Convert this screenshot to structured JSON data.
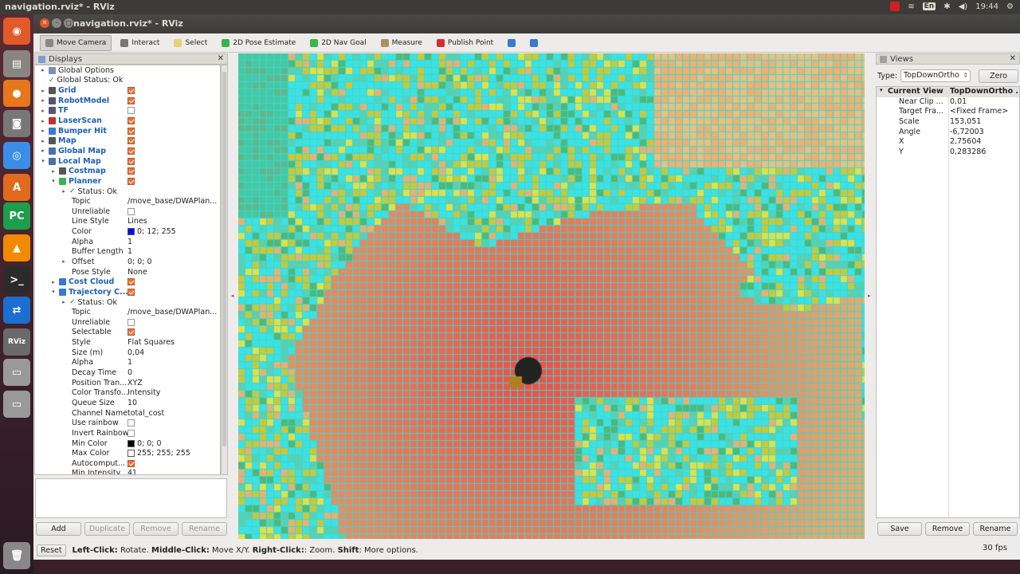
{
  "top_panel": {
    "window_title": "navigation.rviz* - RViz",
    "clock": "19:44",
    "lang": "En"
  },
  "window": {
    "title": "navigation.rviz* - RViz"
  },
  "toolbar": [
    {
      "label": "Move Camera",
      "icon": "move-camera-icon",
      "active": true
    },
    {
      "label": "Interact",
      "icon": "interact-icon",
      "active": false
    },
    {
      "label": "Select",
      "icon": "select-icon",
      "active": false
    },
    {
      "label": "2D Pose Estimate",
      "icon": "pose-estimate-icon",
      "active": false
    },
    {
      "label": "2D Nav Goal",
      "icon": "nav-goal-icon",
      "active": false
    },
    {
      "label": "Measure",
      "icon": "measure-icon",
      "active": false
    },
    {
      "label": "Publish Point",
      "icon": "publish-point-icon",
      "active": false
    },
    {
      "label": "",
      "icon": "plus-icon",
      "active": false
    },
    {
      "label": "",
      "icon": "minus-icon",
      "active": false
    }
  ],
  "displays_panel": {
    "title": "Displays",
    "rows": [
      {
        "indent": 0,
        "arrow": "▸",
        "icon": "gear",
        "name": "Global Options",
        "value": "",
        "blue": false
      },
      {
        "indent": 0,
        "arrow": "",
        "icon": "check",
        "name": "Global Status: Ok",
        "value": "",
        "blue": false
      },
      {
        "indent": 0,
        "arrow": "▸",
        "icon": "grid",
        "name": "Grid",
        "check": true,
        "blue": true
      },
      {
        "indent": 0,
        "arrow": "▸",
        "icon": "robot",
        "name": "RobotModel",
        "check": true,
        "blue": true
      },
      {
        "indent": 0,
        "arrow": "▸",
        "icon": "tf",
        "name": "TF",
        "check": false,
        "blue": true
      },
      {
        "indent": 0,
        "arrow": "▸",
        "icon": "laser",
        "name": "LaserScan",
        "check": true,
        "blue": true
      },
      {
        "indent": 0,
        "arrow": "▸",
        "icon": "bumper",
        "name": "Bumper Hit",
        "check": true,
        "blue": true
      },
      {
        "indent": 0,
        "arrow": "▸",
        "icon": "map",
        "name": "Map",
        "check": true,
        "blue": true
      },
      {
        "indent": 0,
        "arrow": "▸",
        "icon": "folder",
        "name": "Global Map",
        "check": true,
        "blue": true
      },
      {
        "indent": 0,
        "arrow": "▾",
        "icon": "folder",
        "name": "Local Map",
        "check": true,
        "blue": true
      },
      {
        "indent": 1,
        "arrow": "▸",
        "icon": "map",
        "name": "Costmap",
        "check": true,
        "blue": true
      },
      {
        "indent": 1,
        "arrow": "▾",
        "icon": "path",
        "name": "Planner",
        "check": true,
        "blue": true
      },
      {
        "indent": 2,
        "arrow": "▸",
        "icon": "check",
        "name": "Status: Ok",
        "value": "",
        "blue": false
      },
      {
        "indent": 2,
        "arrow": "",
        "icon": "",
        "name": "Topic",
        "value": "/move_base/DWAPlan...",
        "blue": false
      },
      {
        "indent": 2,
        "arrow": "",
        "icon": "",
        "name": "Unreliable",
        "check": false,
        "blue": false
      },
      {
        "indent": 2,
        "arrow": "",
        "icon": "",
        "name": "Line Style",
        "value": "Lines",
        "blue": false
      },
      {
        "indent": 2,
        "arrow": "",
        "icon": "",
        "name": "Color",
        "value": "0; 12; 255",
        "swatch": "#000cff",
        "blue": false
      },
      {
        "indent": 2,
        "arrow": "",
        "icon": "",
        "name": "Alpha",
        "value": "1",
        "blue": false
      },
      {
        "indent": 2,
        "arrow": "",
        "icon": "",
        "name": "Buffer Length",
        "value": "1",
        "blue": false
      },
      {
        "indent": 2,
        "arrow": "▸",
        "icon": "",
        "name": "Offset",
        "value": "0; 0; 0",
        "blue": false
      },
      {
        "indent": 2,
        "arrow": "",
        "icon": "",
        "name": "Pose Style",
        "value": "None",
        "blue": false
      },
      {
        "indent": 1,
        "arrow": "▸",
        "icon": "cloud",
        "name": "Cost Cloud",
        "check": true,
        "blue": true
      },
      {
        "indent": 1,
        "arrow": "▾",
        "icon": "cloud",
        "name": "Trajectory C...",
        "check": true,
        "blue": true
      },
      {
        "indent": 2,
        "arrow": "▸",
        "icon": "check",
        "name": "Status: Ok",
        "value": "",
        "blue": false
      },
      {
        "indent": 2,
        "arrow": "",
        "icon": "",
        "name": "Topic",
        "value": "/move_base/DWAPlan...",
        "blue": false
      },
      {
        "indent": 2,
        "arrow": "",
        "icon": "",
        "name": "Unreliable",
        "check": false,
        "blue": false
      },
      {
        "indent": 2,
        "arrow": "",
        "icon": "",
        "name": "Selectable",
        "check": true,
        "blue": false
      },
      {
        "indent": 2,
        "arrow": "",
        "icon": "",
        "name": "Style",
        "value": "Flat Squares",
        "blue": false
      },
      {
        "indent": 2,
        "arrow": "",
        "icon": "",
        "name": "Size (m)",
        "value": "0,04",
        "blue": false
      },
      {
        "indent": 2,
        "arrow": "",
        "icon": "",
        "name": "Alpha",
        "value": "1",
        "blue": false
      },
      {
        "indent": 2,
        "arrow": "",
        "icon": "",
        "name": "Decay Time",
        "value": "0",
        "blue": false
      },
      {
        "indent": 2,
        "arrow": "",
        "icon": "",
        "name": "Position Tran...",
        "value": "XYZ",
        "blue": false
      },
      {
        "indent": 2,
        "arrow": "",
        "icon": "",
        "name": "Color Transfo...",
        "value": "Intensity",
        "blue": false
      },
      {
        "indent": 2,
        "arrow": "",
        "icon": "",
        "name": "Queue Size",
        "value": "10",
        "blue": false
      },
      {
        "indent": 2,
        "arrow": "",
        "icon": "",
        "name": "Channel Name",
        "value": "total_cost",
        "blue": false
      },
      {
        "indent": 2,
        "arrow": "",
        "icon": "",
        "name": "Use rainbow",
        "check": false,
        "blue": false
      },
      {
        "indent": 2,
        "arrow": "",
        "icon": "",
        "name": "Invert Rainbow",
        "check": false,
        "blue": false
      },
      {
        "indent": 2,
        "arrow": "",
        "icon": "",
        "name": "Min Color",
        "value": "0; 0; 0",
        "swatch": "#000000",
        "blue": false
      },
      {
        "indent": 2,
        "arrow": "",
        "icon": "",
        "name": "Max Color",
        "value": "255; 255; 255",
        "swatch": "#ffffff",
        "blue": false
      },
      {
        "indent": 2,
        "arrow": "",
        "icon": "",
        "name": "Autocomput...",
        "check": true,
        "blue": false
      },
      {
        "indent": 2,
        "arrow": "",
        "icon": "",
        "name": "Min Intensity",
        "value": "41",
        "blue": false
      }
    ],
    "buttons": {
      "add": "Add",
      "duplicate": "Duplicate",
      "remove": "Remove",
      "rename": "Rename"
    }
  },
  "views_panel": {
    "title": "Views",
    "type_label": "Type:",
    "type_value": "TopDownOrtho",
    "zero": "Zero",
    "current_view": {
      "key": "Current View",
      "value": "TopDownOrtho ..."
    },
    "props": [
      {
        "k": "Near Clip ...",
        "v": "0,01"
      },
      {
        "k": "Target Fra...",
        "v": "<Fixed Frame>"
      },
      {
        "k": "Scale",
        "v": "153,051"
      },
      {
        "k": "Angle",
        "v": "-6,72003"
      },
      {
        "k": "X",
        "v": "2,75604"
      },
      {
        "k": "Y",
        "v": "0,283286"
      }
    ],
    "buttons": {
      "save": "Save",
      "remove": "Remove",
      "rename": "Rename"
    }
  },
  "statusbar": {
    "reset": "Reset",
    "hint_parts": [
      {
        "text": "Left-Click:",
        "bold": true
      },
      {
        "text": " Rotate. ",
        "bold": false
      },
      {
        "text": "Middle-Click:",
        "bold": true
      },
      {
        "text": " Move X/Y. ",
        "bold": false
      },
      {
        "text": "Right-Click:",
        "bold": true
      },
      {
        "text": ": Zoom. ",
        "bold": false
      },
      {
        "text": "Shift",
        "bold": true
      },
      {
        "text": ": More options.",
        "bold": false
      }
    ],
    "fps": "30 fps"
  },
  "launcher": [
    {
      "icon": "ubuntu-logo-icon",
      "glyph": "◉",
      "color": "#e05a2a"
    },
    {
      "icon": "files-icon",
      "glyph": "▤",
      "color": "#8a8580"
    },
    {
      "icon": "firefox-icon",
      "glyph": "●",
      "color": "#e8761a"
    },
    {
      "icon": "camera-icon",
      "glyph": "◙",
      "color": "#777"
    },
    {
      "icon": "chrome-icon",
      "glyph": "◎",
      "color": "#3a8ee8"
    },
    {
      "icon": "software-center-icon",
      "glyph": "A",
      "color": "#e06b1c"
    },
    {
      "icon": "pycharm-icon",
      "glyph": "PC",
      "color": "#1d9e4a"
    },
    {
      "icon": "vlc-icon",
      "glyph": "▲",
      "color": "#f28a00"
    },
    {
      "icon": "terminal-icon",
      "glyph": ">_",
      "color": "#2b2b2b"
    },
    {
      "icon": "teamviewer-icon",
      "glyph": "⇄",
      "color": "#1a6fd0"
    },
    {
      "icon": "rviz-icon",
      "glyph": "RViz",
      "color": "#6a6a6a"
    },
    {
      "icon": "drive-icon",
      "glyph": "▭",
      "color": "#999"
    },
    {
      "icon": "drive-icon-2",
      "glyph": "▭",
      "color": "#999"
    },
    {
      "icon": "trash-icon",
      "glyph": "🗑",
      "color": "#888"
    }
  ]
}
